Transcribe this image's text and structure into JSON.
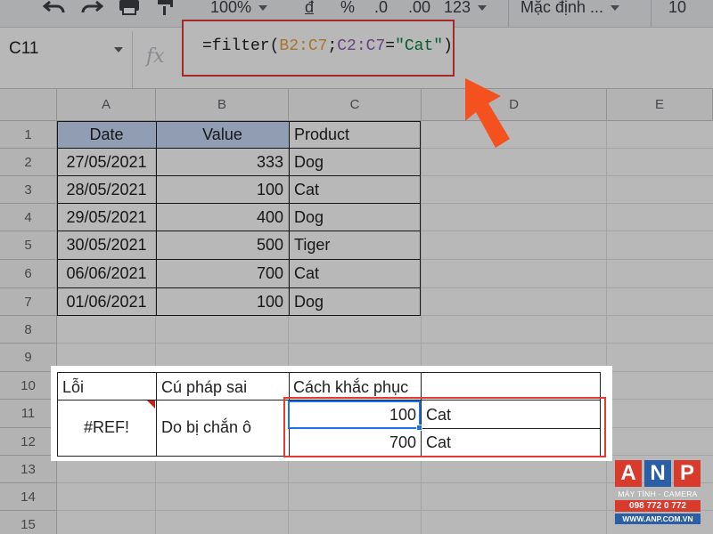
{
  "toolbar": {
    "zoom": "100%",
    "currency": "đ",
    "percent": "%",
    "decrease_decimal": ".0",
    "increase_decimal": ".00",
    "more_formats": "123",
    "font": "Mặc định ...",
    "font_size": "10"
  },
  "formula_bar": {
    "name_box": "C11",
    "fx": "fx",
    "formula_prefix": "=filter(",
    "formula_ref1": "B2:C7",
    "formula_sep": ";",
    "formula_ref2": "C2:C7",
    "formula_eq": "=",
    "formula_str": "\"Cat\"",
    "formula_close": ")"
  },
  "columns": [
    "A",
    "B",
    "C",
    "D",
    "E"
  ],
  "rows": [
    "1",
    "2",
    "3",
    "4",
    "5",
    "6",
    "7",
    "8",
    "9",
    "10",
    "11",
    "12",
    "13",
    "14",
    "15"
  ],
  "table": {
    "headers": [
      "Date",
      "Value",
      "Product"
    ],
    "rows": [
      [
        "27/05/2021",
        "333",
        "Dog"
      ],
      [
        "28/05/2021",
        "100",
        "Cat"
      ],
      [
        "29/05/2021",
        "400",
        "Dog"
      ],
      [
        "30/05/2021",
        "500",
        "Tiger"
      ],
      [
        "06/06/2021",
        "700",
        "Cat"
      ],
      [
        "01/06/2021",
        "100",
        "Dog"
      ]
    ]
  },
  "error_table": {
    "headers": [
      "Lỗi",
      "Cú pháp sai",
      "Cách khắc phục"
    ],
    "error": "#REF!",
    "cause": "Do bị chắn ô",
    "results": [
      [
        "100",
        "Cat"
      ],
      [
        "700",
        "Cat"
      ]
    ]
  },
  "watermark": {
    "letters": [
      "A",
      "N",
      "P"
    ],
    "tagline": "MÁY TÍNH · CAMERA",
    "phone": "098 772 0 772",
    "website": "WWW.ANP.COM.VN"
  },
  "colors": {
    "accent_red": "#e53935",
    "selection_blue": "#1a73e8",
    "header_fill": "#c9daf8",
    "arrow": "#f4511e"
  }
}
